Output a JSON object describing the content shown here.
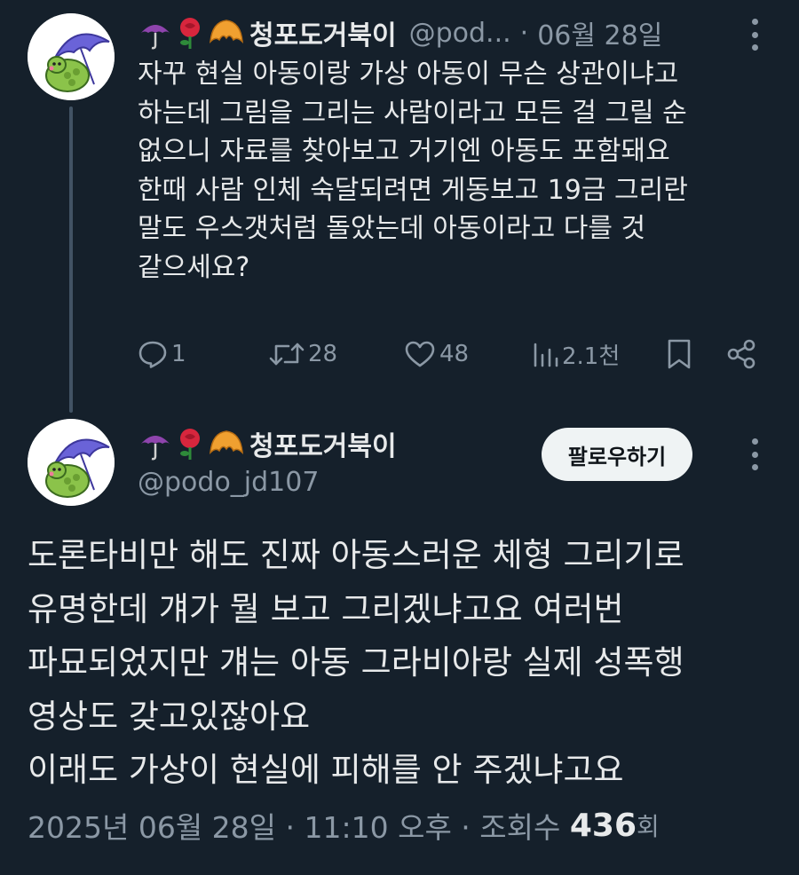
{
  "tweet1": {
    "display_name": "청포도거북이",
    "handle": "@pod...",
    "separator": "·",
    "date": "06월 28일",
    "lines": [
      "자꾸 현실 아동이랑 가상 아동이 무슨 상관이냐고",
      "하는데 그림을 그리는 사람이라고 모든 걸 그릴 순",
      "없으니 자료를 찾아보고 거기엔 아동도 포함돼요",
      "한때 사람 인체 숙달되려면 게동보고 19금 그리란",
      "말도 우스갯처럼 돌았는데 아동이라고 다를 것",
      "같으세요?"
    ],
    "actions": {
      "replies": "1",
      "retweets": "28",
      "likes": "48",
      "views": "2.1천"
    }
  },
  "tweet2": {
    "display_name": "청포도거북이",
    "handle": "@podo_jd107",
    "follow_label": "팔로우하기",
    "lines": [
      "도론타비만 해도 진짜 아동스러운 체형 그리기로",
      "유명한데 걔가 뭘 보고 그리겠냐고요 여러번",
      "파묘되었지만 걔는 아동 그라비아랑 실제 성폭행",
      "영상도 갖고있잖아요",
      "이래도 가상이 현실에 피해를 안 주겠냐고요"
    ],
    "timestamp": "2025년 06월 28일 · 11:10 오후 · 조회수",
    "views_count": "436",
    "views_unit": "회"
  },
  "icons": [
    "umbrella-icon",
    "rose-icon",
    "croissant-icon",
    "reply-icon",
    "retweet-icon",
    "like-icon",
    "views-icon",
    "bookmark-icon",
    "share-icon",
    "more-icon"
  ],
  "colors": {
    "background": "#15202b",
    "text_primary": "#e7e9ea",
    "text_secondary": "#8b98a5",
    "follow_button_bg": "#eff3f4"
  }
}
